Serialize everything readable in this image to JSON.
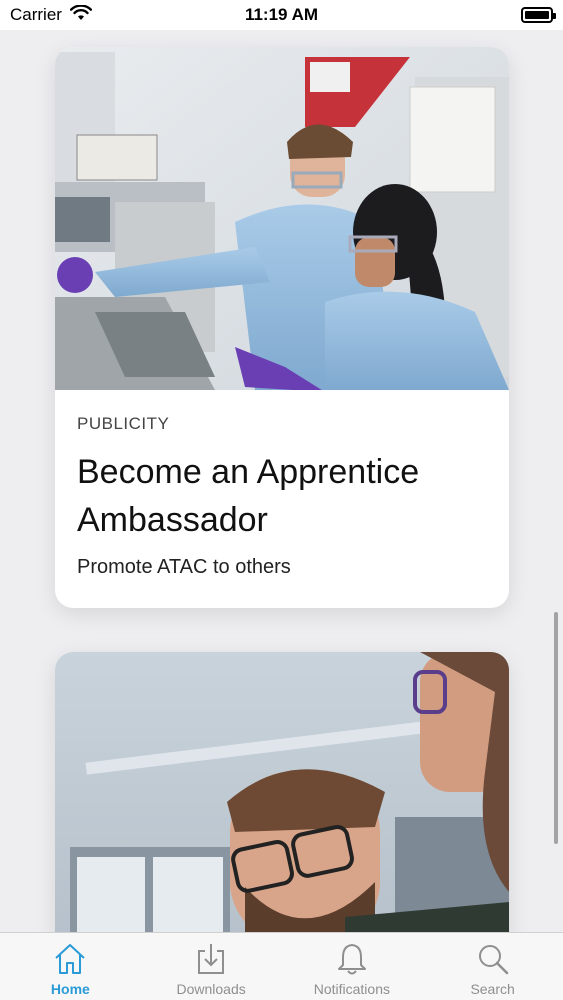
{
  "status_bar": {
    "carrier": "Carrier",
    "time": "11:19 AM"
  },
  "cards": [
    {
      "image_desc": "lab-scientists-photo",
      "category": "PUBLICITY",
      "title": "Become an Apprentice Ambassador",
      "subtitle": "Promote ATAC to others"
    },
    {
      "image_desc": "scientist-with-glasses-photo"
    }
  ],
  "tabs": [
    {
      "label": "Home",
      "icon": "home-icon",
      "active": true
    },
    {
      "label": "Downloads",
      "icon": "download-icon",
      "active": false
    },
    {
      "label": "Notifications",
      "icon": "bell-icon",
      "active": false
    },
    {
      "label": "Search",
      "icon": "search-icon",
      "active": false
    }
  ],
  "colors": {
    "accent": "#2a9bd6",
    "inactive": "#8f8f8f",
    "background": "#eeeef0"
  }
}
